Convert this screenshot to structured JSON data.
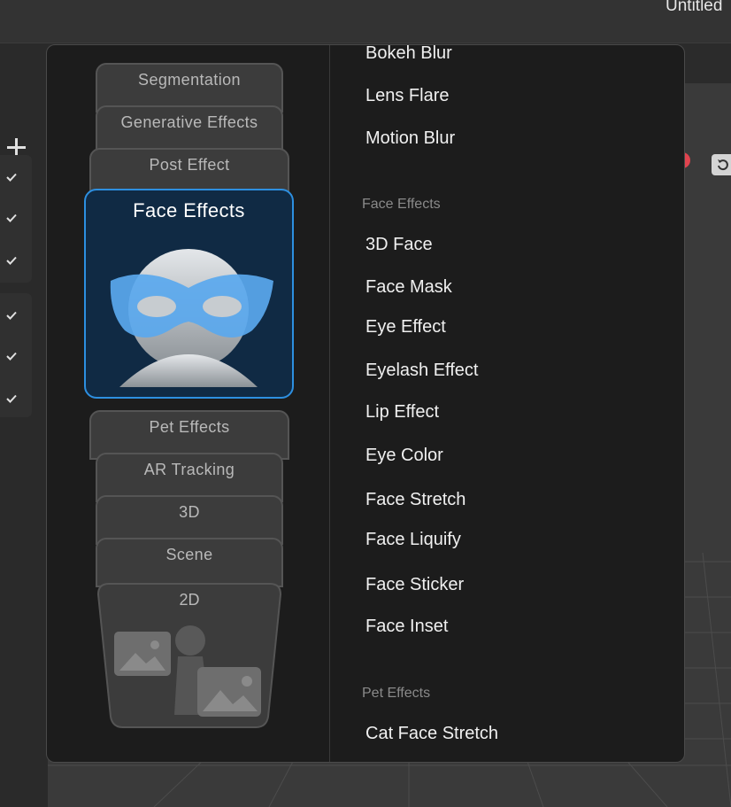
{
  "window": {
    "title": "Untitled"
  },
  "popup": {
    "categories": {
      "segmentation": "Segmentation",
      "generative": "Generative Effects",
      "post_effect": "Post Effect",
      "active": "Face Effects",
      "pet_effects": "Pet Effects",
      "ar_tracking": "AR Tracking",
      "three_d": "3D",
      "scene": "Scene",
      "two_d": "2D"
    },
    "list": {
      "post_items": [
        "Bokeh Blur",
        "Lens Flare",
        "Motion Blur"
      ],
      "face_section": "Face Effects",
      "face_items": [
        "3D Face",
        "Face Mask",
        "Eye Effect",
        "Eyelash Effect",
        "Lip Effect",
        "Eye Color",
        "Face Stretch",
        "Face Liquify",
        "Face Sticker",
        "Face Inset"
      ],
      "pet_section": "Pet Effects",
      "pet_items": [
        "Cat Face Stretch"
      ]
    }
  },
  "colors": {
    "accent": "#2d8fe0",
    "active_card_bg": "#102a44",
    "popup_bg": "#1c1c1c",
    "notify": "#e0444f"
  },
  "icons": [
    "plus-icon",
    "check-icon",
    "reset-icon",
    "mask-face-icon",
    "image-person-icon"
  ]
}
